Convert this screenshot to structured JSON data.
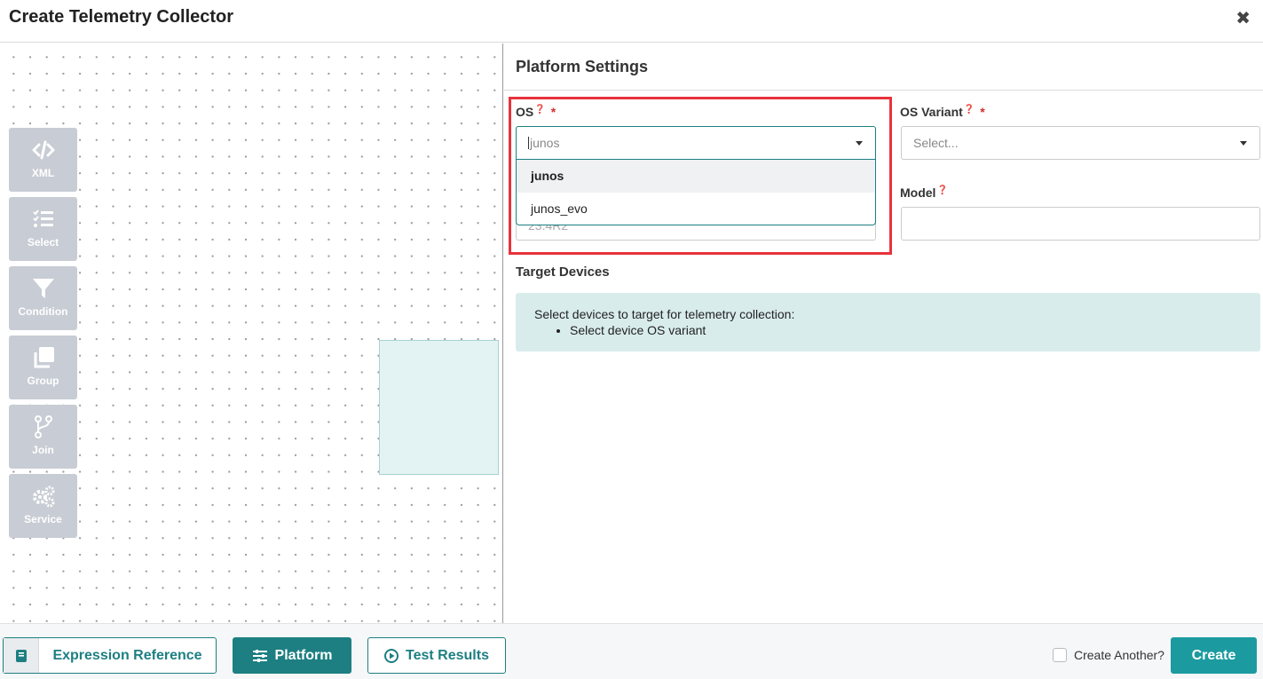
{
  "header": {
    "title": "Create Telemetry Collector",
    "close_icon": "close-icon"
  },
  "toolbox": [
    {
      "label": "XML",
      "icon": "code-icon"
    },
    {
      "label": "Select",
      "icon": "list-check-icon"
    },
    {
      "label": "Condition",
      "icon": "filter-icon"
    },
    {
      "label": "Group",
      "icon": "layers-icon"
    },
    {
      "label": "Join",
      "icon": "branch-icon"
    },
    {
      "label": "Service",
      "icon": "gears-icon"
    }
  ],
  "panel": {
    "title": "Platform Settings",
    "os": {
      "label": "OS",
      "required_mark": "*",
      "help_icon": "?",
      "value": "junos",
      "options": [
        "junos",
        "junos_evo"
      ],
      "highlighted_option": "junos",
      "underlying_value": "23.4R2"
    },
    "os_variant": {
      "label": "OS Variant",
      "required_mark": "*",
      "help_icon": "?",
      "placeholder": "Select..."
    },
    "model": {
      "label": "Model",
      "help_icon": "?",
      "value": ""
    },
    "target_devices": {
      "title": "Target Devices",
      "message": "Select devices to target for telemetry collection:",
      "items": [
        "Select device OS variant"
      ]
    }
  },
  "footer": {
    "expression_reference": "Expression Reference",
    "platform": "Platform",
    "test_results": "Test Results",
    "create_another": "Create Another?",
    "create": "Create"
  },
  "colors": {
    "accent": "#1d7f82",
    "create": "#1b9ba0",
    "highlight": "#e8333b",
    "info_bg": "#d9ecec",
    "tool_bg": "#c8ccd4"
  }
}
